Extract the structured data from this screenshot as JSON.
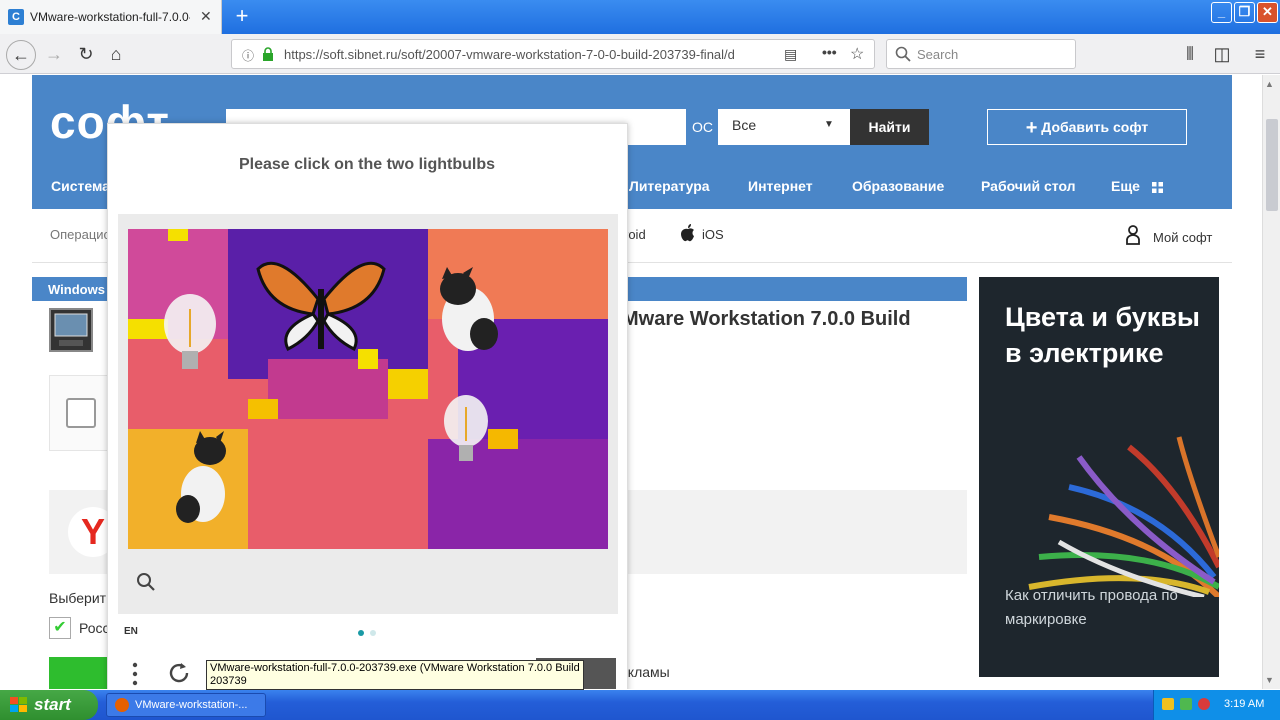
{
  "browser": {
    "tab_title": "VMware-workstation-full-7.0.0-2037...",
    "tab_favicon": "С",
    "url": "https://soft.sibnet.ru/soft/20007-vmware-workstation-7-0-0-build-203739-final/d",
    "search_placeholder": "Search",
    "window_buttons": [
      "_",
      "❐",
      "✕"
    ]
  },
  "site": {
    "logo": "софт",
    "os_label": "ОС",
    "os_value": "Все",
    "find_button": "Найти",
    "add_button": "Добавить софт",
    "categories": [
      "Система",
      "Литература",
      "Интернет",
      "Образование",
      "Рабочий стол",
      "Еще"
    ],
    "subnav": [
      "Операцио",
      "roid",
      "iOS",
      "Мой софт"
    ],
    "section": "Windows",
    "page_title": "Mware Workstation 7.0.0 Build",
    "choose_text": "Выберит",
    "checkbox_label": "Росс",
    "ads_text": "екламы",
    "yandex_letter": "Y"
  },
  "ad": {
    "headline": "Цвета и буквы в электрике",
    "subline": "Как отличить провода по маркировке"
  },
  "captcha": {
    "prompt": "Please click on the two lightbulbs",
    "lang": "EN",
    "colors": {
      "accent": "#1a9aa5",
      "dot_inactive": "#cfe8ea"
    }
  },
  "tooltip": "VMware-workstation-full-7.0.0-203739.exe (VMware Workstation 7.0.0 Build 203739",
  "taskbar": {
    "start": "start",
    "task_item": "VMware-workstation-...",
    "clock": "3:19 AM"
  }
}
